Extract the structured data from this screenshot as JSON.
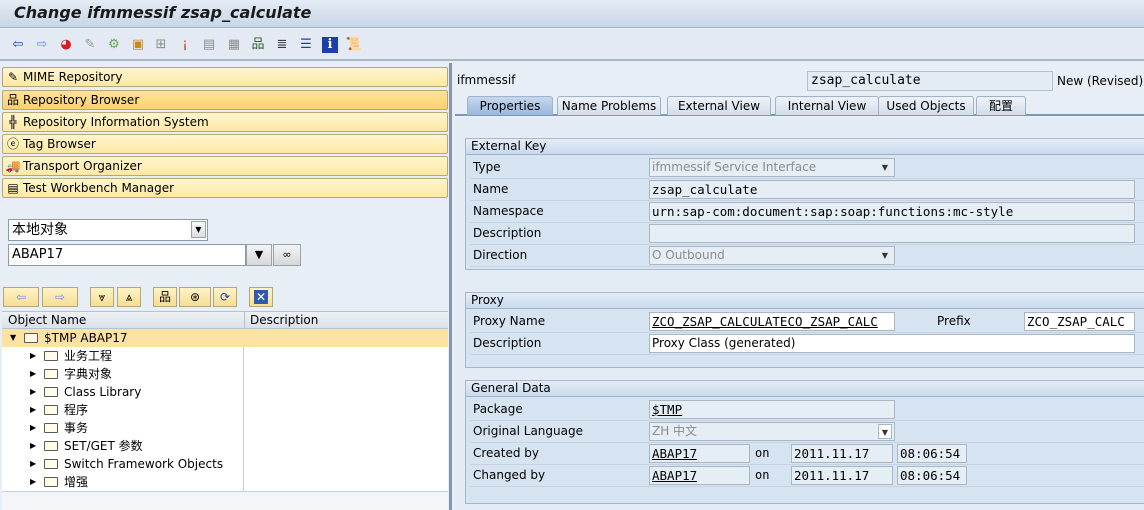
{
  "window": {
    "title": "Change ifmmessif zsap_calculate"
  },
  "toolbar": {
    "icons": [
      {
        "name": "back-icon",
        "glyph": "⇦",
        "color": "#1c3fa8"
      },
      {
        "name": "forward-icon",
        "glyph": "⇨",
        "color": "#6f8fcf"
      },
      {
        "name": "display-change-icon",
        "glyph": "◕",
        "color": "#d51e1e"
      },
      {
        "name": "check-icon",
        "glyph": "✎",
        "color": "#9a9a9a"
      },
      {
        "name": "activate-icon",
        "glyph": "⚙",
        "color": "#67a35a"
      },
      {
        "name": "other-object-icon",
        "glyph": "▣",
        "color": "#c98a1b"
      },
      {
        "name": "where-used-icon",
        "glyph": "⊞",
        "color": "#8c8c8c"
      },
      {
        "name": "test-icon",
        "glyph": "¡",
        "color": "#c93a1b"
      },
      {
        "name": "display-object-list-icon",
        "glyph": "▤",
        "color": "#8c8c8c"
      },
      {
        "name": "navigation-window-icon",
        "glyph": "▦",
        "color": "#8c8c8c"
      },
      {
        "name": "hierarchy-icon",
        "glyph": "品",
        "color": "#2e5e2e"
      },
      {
        "name": "stack-icon",
        "glyph": "≣",
        "color": "#3a3a3a"
      },
      {
        "name": "list-icon",
        "glyph": "☰",
        "color": "#1c3fa8"
      },
      {
        "name": "info-icon",
        "glyph": "i",
        "color": "#ffffff"
      },
      {
        "name": "scroll-icon",
        "glyph": "📜",
        "color": "#7a6a2a"
      }
    ]
  },
  "nav": {
    "items": [
      {
        "label": "MIME Repository",
        "icon": "mime-repository-icon",
        "glyph": "✎",
        "active": false
      },
      {
        "label": "Repository Browser",
        "icon": "repository-browser-icon",
        "glyph": "品",
        "active": true
      },
      {
        "label": "Repository Information System",
        "icon": "repository-info-icon",
        "glyph": "╬",
        "active": false
      },
      {
        "label": "Tag Browser",
        "icon": "tag-browser-icon",
        "glyph": "ⓔ",
        "active": false
      },
      {
        "label": "Transport Organizer",
        "icon": "transport-truck-icon",
        "glyph": "🚚",
        "active": false
      },
      {
        "label": "Test Workbench Manager",
        "icon": "test-workbench-icon",
        "glyph": "▤",
        "active": false
      }
    ]
  },
  "browser": {
    "object_type": "本地对象",
    "user_value": "ABAP17",
    "columns": [
      "Object Name",
      "Description"
    ],
    "tree": [
      {
        "label": "$TMP ABAP17",
        "level": 0,
        "expanded": true,
        "selected": true
      },
      {
        "label": "业务工程",
        "level": 1
      },
      {
        "label": "字典对象",
        "level": 1
      },
      {
        "label": "Class Library",
        "level": 1
      },
      {
        "label": "程序",
        "level": 1
      },
      {
        "label": "事务",
        "level": 1
      },
      {
        "label": "SET/GET 参数",
        "level": 1
      },
      {
        "label": "Switch Framework Objects",
        "level": 1
      },
      {
        "label": "增强",
        "level": 1
      }
    ]
  },
  "detail": {
    "object_type": "ifmmessif",
    "object_name": "zsap_calculate",
    "status": "New (Revised)",
    "tabs": [
      {
        "label": "Properties",
        "active": true
      },
      {
        "label": "Name Problems"
      },
      {
        "label": "External View"
      },
      {
        "label": "Internal View"
      },
      {
        "label": "Used Objects"
      },
      {
        "label": "配置"
      }
    ],
    "external_key": {
      "title": "External Key",
      "type_label": "Type",
      "type_value": "ifmmessif Service Interface",
      "name_label": "Name",
      "name_value": "zsap_calculate",
      "namespace_label": "Namespace",
      "namespace_value": "urn:sap-com:document:sap:soap:functions:mc-style",
      "description_label": "Description",
      "description_value": "",
      "direction_label": "Direction",
      "direction_value": "O Outbound"
    },
    "proxy": {
      "title": "Proxy",
      "proxy_name_label": "Proxy Name",
      "proxy_name_value": "ZCO_ZSAP_CALCULATECO_ZSAP_CALC",
      "prefix_label": "Prefix",
      "prefix_value": "ZCO_ZSAP_CALC",
      "description_label": "Description",
      "description_value": "Proxy Class (generated)"
    },
    "general": {
      "title": "General Data",
      "package_label": "Package",
      "package_value": "$TMP",
      "language_label": "Original Language",
      "language_value": "ZH 中文",
      "created_label": "Created by",
      "created_user": "ABAP17",
      "created_on": "on",
      "created_date": "2011.11.17",
      "created_time": "08:06:54",
      "changed_label": "Changed by",
      "changed_user": "ABAP17",
      "changed_on": "on",
      "changed_date": "2011.11.17",
      "changed_time": "08:06:54"
    }
  }
}
